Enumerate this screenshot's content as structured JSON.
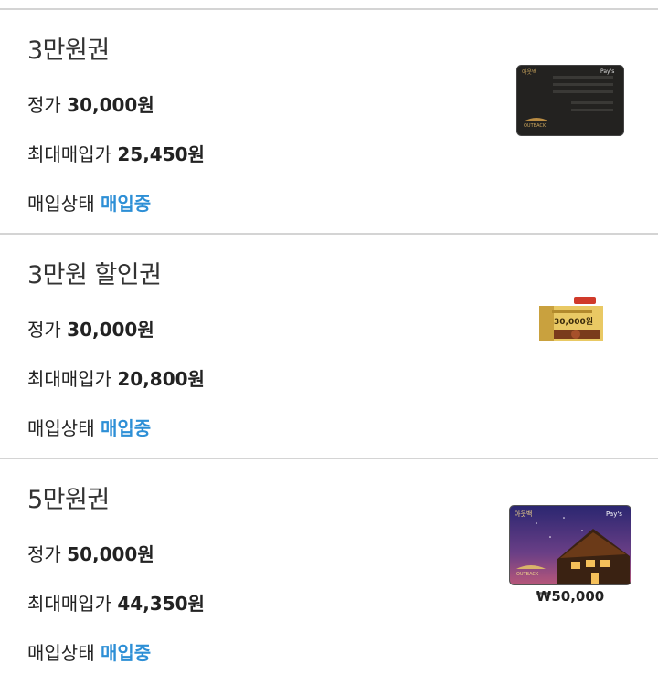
{
  "items": [
    {
      "title": "3만원권",
      "price_label": "정가",
      "price_value": "30,000원",
      "max_label": "최대매입가",
      "max_value": "25,450원",
      "status_label": "매입상태",
      "status_value": "매입중",
      "card": {
        "icon": "outback-black-card",
        "brand_text": "아웃백",
        "pay_text": "Pay's",
        "logo_text": "OUTBACK"
      }
    },
    {
      "title": "3만원 할인권",
      "price_label": "정가",
      "price_value": "30,000원",
      "max_label": "최대매입가",
      "max_value": "20,800원",
      "status_label": "매입상태",
      "status_value": "매입중",
      "card": {
        "icon": "outback-gold-voucher",
        "amount_text": "30,000원"
      }
    },
    {
      "title": "5만원권",
      "price_label": "정가",
      "price_value": "50,000원",
      "max_label": "최대매입가",
      "max_value": "44,350원",
      "status_label": "매입상태",
      "status_value": "매입중",
      "card": {
        "icon": "outback-night-card",
        "brand_text": "아웃백",
        "pay_text": "Pay's",
        "logo_text": "OUTBACK",
        "caption": "₩50,000"
      }
    }
  ],
  "colors": {
    "status": "#2d8fd6",
    "divider": "#d4d4d4",
    "text": "#222222"
  }
}
